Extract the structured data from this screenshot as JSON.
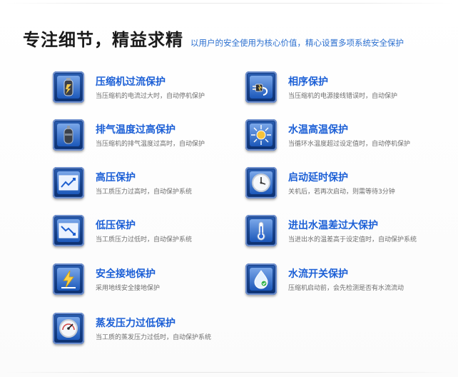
{
  "header": {
    "title": "专注细节，精益求精",
    "subtitle": "以用户的安全使用为核心价值，精心设置多项系统安全保护"
  },
  "items": [
    {
      "title": "压缩机过流保护",
      "desc": "当压缩机的电流过大时，自动停机保护",
      "icon": "compressor-icon"
    },
    {
      "title": "相序保护",
      "desc": "当压缩机的电源接线错误时，自动保护",
      "icon": "plug-icon"
    },
    {
      "title": "排气温度过高保护",
      "desc": "当压缩机的排气温度过高时，自动保护",
      "icon": "cylinder-icon"
    },
    {
      "title": "水温高温保护",
      "desc": "当循环水温度超过设定值时，自动停机保护",
      "icon": "sun-icon"
    },
    {
      "title": "高压保护",
      "desc": "当工质压力过高时，自动保护系统",
      "icon": "chart-up-icon"
    },
    {
      "title": "启动延时保护",
      "desc": "关机后，若再次启动，则需等待3分钟",
      "icon": "clock-icon"
    },
    {
      "title": "低压保护",
      "desc": "当工质压力过低时，自动保护系统",
      "icon": "chart-down-icon"
    },
    {
      "title": "进出水温差过大保护",
      "desc": "当进出水的温差高于设定值时，自动保护系统",
      "icon": "thermometer-icon"
    },
    {
      "title": "安全接地保护",
      "desc": "采用地线安全接地保护",
      "icon": "lightning-icon"
    },
    {
      "title": "水流开关保护",
      "desc": "压缩机启动前，会先检测是否有水流流动",
      "icon": "water-drop-icon"
    },
    {
      "title": "蒸发压力过低保护",
      "desc": "当工质的蒸发压力过低时，自动保护系统",
      "icon": "gauge-icon"
    }
  ]
}
